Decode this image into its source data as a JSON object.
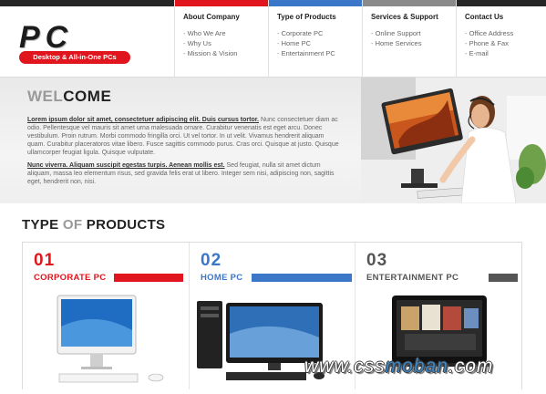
{
  "logo": {
    "brand": "PC",
    "tagline": "Desktop & All-in-One PCs"
  },
  "nav": [
    {
      "title": "About Company",
      "color": "#e0151d",
      "links": [
        "Who We Are",
        "Why Us",
        "Mission & Vision"
      ]
    },
    {
      "title": "Type of Products",
      "color": "#3a77c8",
      "links": [
        "Corporate PC",
        "Home PC",
        "Entertainment PC"
      ]
    },
    {
      "title": "Services & Support",
      "color": "#8a8a8a",
      "links": [
        "Online Support",
        "Home Services"
      ]
    },
    {
      "title": "Contact Us",
      "color": "#262626",
      "links": [
        "Office Address",
        "Phone & Fax",
        "E-mail"
      ]
    }
  ],
  "welcome": {
    "title_part1": "WEL",
    "title_part2": "COME",
    "p1_lead": "Lorem ipsum dolor sit amet, consectetuer adipiscing elit. Duis cursus tortor.",
    "p1_body": " Nunc consectetuer diam ac odio. Pellentesque vel mauris sit amet urna malesuada ornare. Curabitur venenatis est eget arcu. Donec vestibulum. Proin rutrum. Morbi commodo fringilla orci. Ut vel tortor. In ut velit. Vivamus hendrerit aliquam quam. Curabitur placeratoros vitae libero. Fusce sagittis commodo purus. Cras orci. Quisque at justo. Quisque ullamcorper feugiat ligula. Quisque vulputate.",
    "p2_lead": "Nunc viverra. Aliquam suscipit egestas turpis. Aenean mollis est.",
    "p2_body": " Sed feugiat, nulla sit amet dictum aliquam, massa leo elementum risus, sed gravida felis erat ut libero. Integer sem nisi, adipiscing non, sagittis eget, hendrerit non, nisi."
  },
  "products_title": {
    "part1": "TYPE ",
    "part2": "OF ",
    "part3": "PRODUCTS"
  },
  "products": [
    {
      "num": "01",
      "label": "CORPORATE PC",
      "color": "#e0151d"
    },
    {
      "num": "02",
      "label": "HOME PC",
      "color": "#3a77c8"
    },
    {
      "num": "03",
      "label": "ENTERTAINMENT PC",
      "color": "#555555"
    }
  ],
  "watermark": {
    "part1": "www.css",
    "part2": "moban",
    "part3": ".com"
  }
}
